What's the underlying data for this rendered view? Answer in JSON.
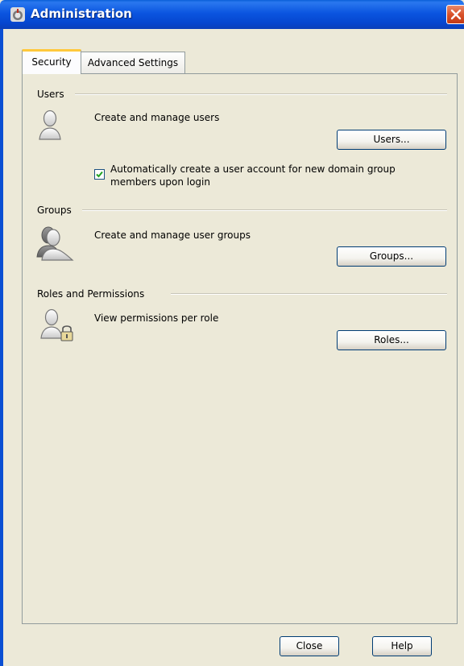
{
  "window": {
    "title": "Administration"
  },
  "tabs": [
    {
      "label": "Security",
      "selected": true
    },
    {
      "label": "Advanced Settings",
      "selected": false
    }
  ],
  "sections": {
    "users": {
      "heading": "Users",
      "description": "Create and manage users",
      "button_label": "Users...",
      "checkbox_label_line1": "Automatically create a user account for new domain group",
      "checkbox_label_line2": "members upon login",
      "checkbox_checked": true
    },
    "groups": {
      "heading": "Groups",
      "description": "Create and manage user groups",
      "button_label": "Groups..."
    },
    "roles": {
      "heading": "Roles and Permissions",
      "description": "View permissions per role",
      "button_label": "Roles..."
    }
  },
  "footer": {
    "close_label": "Close",
    "help_label": "Help"
  },
  "icons": {
    "app": "app-icon",
    "close": "close-icon",
    "users": "user-icon",
    "groups": "group-icon",
    "roles": "user-lock-icon",
    "check": "checkmark-icon"
  },
  "colors": {
    "titlebar": "#0b55e0",
    "accent_tab": "#ffc83c",
    "window_bg": "#ece9d8"
  }
}
